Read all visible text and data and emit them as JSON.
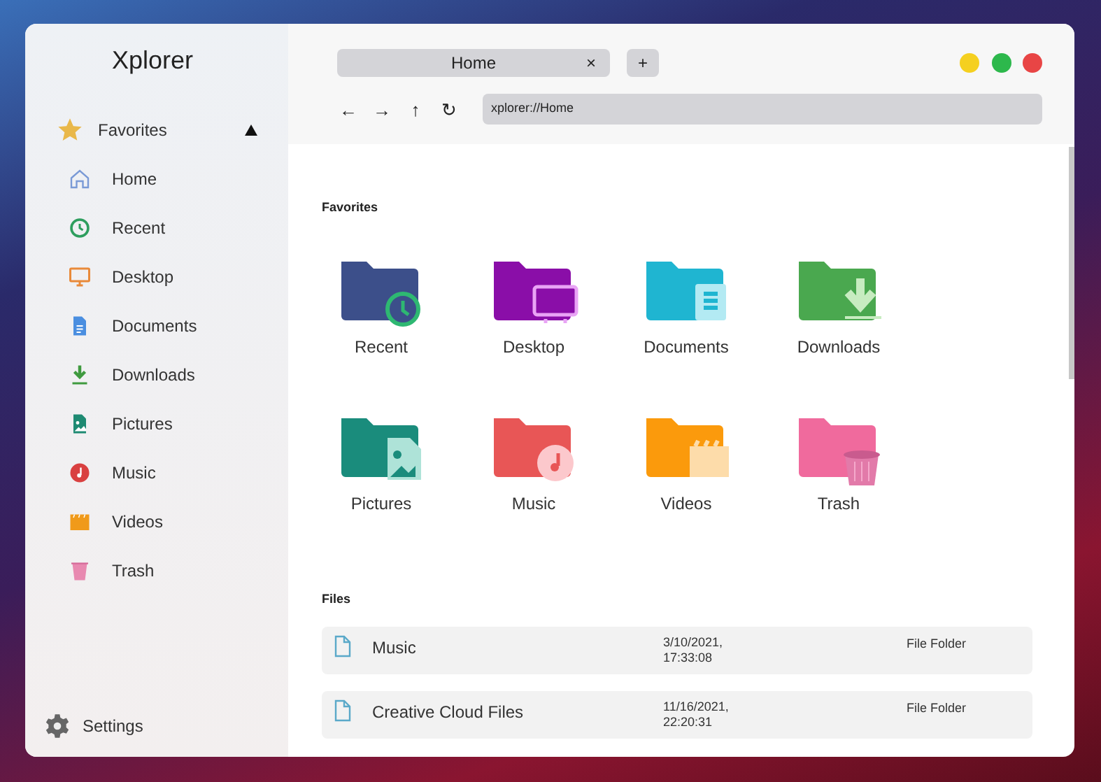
{
  "app_title": "Xplorer",
  "sidebar": {
    "section": {
      "label": "Favorites",
      "expanded": true
    },
    "items": [
      {
        "label": "Home"
      },
      {
        "label": "Recent"
      },
      {
        "label": "Desktop"
      },
      {
        "label": "Documents"
      },
      {
        "label": "Downloads"
      },
      {
        "label": "Pictures"
      },
      {
        "label": "Music"
      },
      {
        "label": "Videos"
      },
      {
        "label": "Trash"
      }
    ],
    "settings": "Settings"
  },
  "tabs": [
    {
      "label": "Home",
      "close": "×",
      "selected": true
    }
  ],
  "new_tab": "+",
  "nav": [
    "←",
    "→",
    "↑",
    "↻"
  ],
  "address": "xplorer://Home",
  "favorites": {
    "heading": "Favorites",
    "items": [
      {
        "label": "Recent",
        "color": "#3c4f8a"
      },
      {
        "label": "Desktop",
        "color": "#8a0ea8"
      },
      {
        "label": "Documents",
        "color": "#1fb5d1"
      },
      {
        "label": "Downloads",
        "color": "#4aa84f"
      },
      {
        "label": "Pictures",
        "color": "#1a8c7c"
      },
      {
        "label": "Music",
        "color": "#e85656"
      },
      {
        "label": "Videos",
        "color": "#fb9a0c"
      },
      {
        "label": "Trash",
        "color": "#f06a9d"
      }
    ]
  },
  "files": {
    "heading": "Files",
    "rows": [
      {
        "name": "Music",
        "modified": "3/10/2021,\n17:33:08",
        "type": "File Folder"
      },
      {
        "name": "Creative Cloud Files",
        "modified": "11/16/2021,\n22:20:31",
        "type": "File Folder"
      }
    ]
  }
}
